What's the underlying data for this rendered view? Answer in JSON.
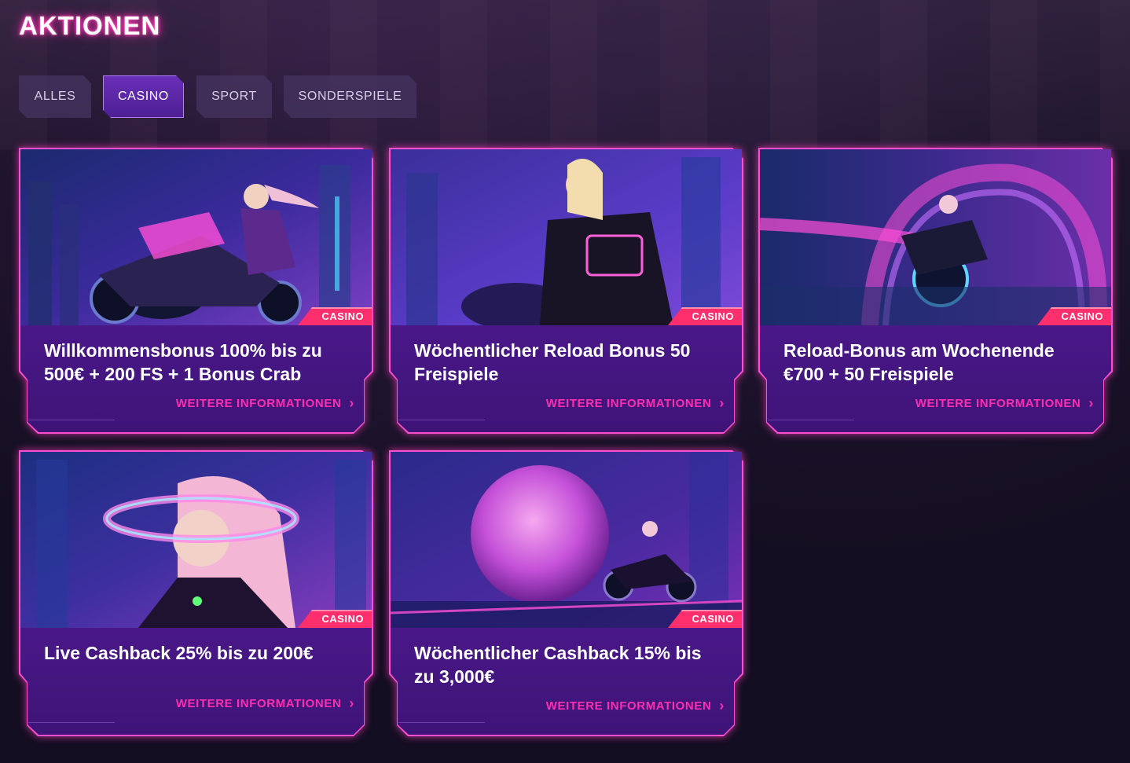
{
  "page": {
    "title": "AKTIONEN"
  },
  "tabs": [
    {
      "label": "ALLES",
      "active": false
    },
    {
      "label": "CASINO",
      "active": true
    },
    {
      "label": "SPORT",
      "active": false
    },
    {
      "label": "SONDERSPIELE",
      "active": false
    }
  ],
  "colors": {
    "accent": "#ff2fb0",
    "badge": "#ff2f6e",
    "card": "#4a1888",
    "background": "#140e22"
  },
  "cards": [
    {
      "badge": "CASINO",
      "title": "Willkommensbonus 100% bis zu 500€ + 200 FS + 1 Bonus Crab",
      "link": "WEITERE INFORMATIONEN",
      "art": "rider-motorcycle-city"
    },
    {
      "badge": "CASINO",
      "title": "Wöchentlicher Reload Bonus 50 Freispiele",
      "link": "WEITERE INFORMATIONEN",
      "art": "rider-jacket-777"
    },
    {
      "badge": "CASINO",
      "title": "Reload-Bonus am Wochenende €700 + 50 Freispiele",
      "link": "WEITERE INFORMATIONEN",
      "art": "motorcycle-neon-loop"
    },
    {
      "badge": "CASINO",
      "title": "Live Cashback 25% bis zu 200€",
      "link": "WEITERE INFORMATIONEN",
      "art": "woman-holo-visor"
    },
    {
      "badge": "CASINO",
      "title": "Wöchentlicher Cashback 15% bis zu 3,000€",
      "link": "WEITERE INFORMATIONEN",
      "art": "pink-sphere-rider"
    }
  ]
}
